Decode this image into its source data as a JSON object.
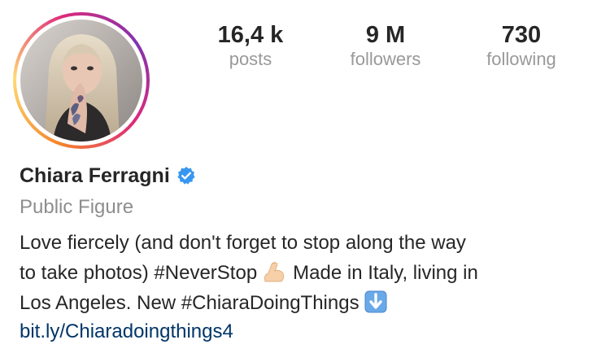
{
  "profile": {
    "name": "Chiara Ferragni",
    "category": "Public Figure",
    "bio_line_1": "Love fiercely (and don't forget to stop along the way",
    "bio_line_2_a": "to take photos) #NeverStop",
    "bio_line_2_b": "Made in Italy, living in",
    "bio_line_3": "Los Angeles. New #ChiaraDoingThings",
    "link": "bit.ly/Chiaradoingthings4",
    "verified_icon": "verified-badge-icon",
    "emoji_1": "flexed-biceps-icon",
    "emoji_2": "down-arrow-button-icon"
  },
  "stats": {
    "posts_value": "16,4 k",
    "posts_label": "posts",
    "followers_value": "9 M",
    "followers_label": "followers",
    "following_value": "730",
    "following_label": "following"
  },
  "colors": {
    "verified_blue": "#3897f0",
    "secondary_text": "#999999",
    "link": "#003569",
    "story_ring": [
      "#f58529",
      "#feda77",
      "#dd2a7b",
      "#8134af"
    ]
  }
}
